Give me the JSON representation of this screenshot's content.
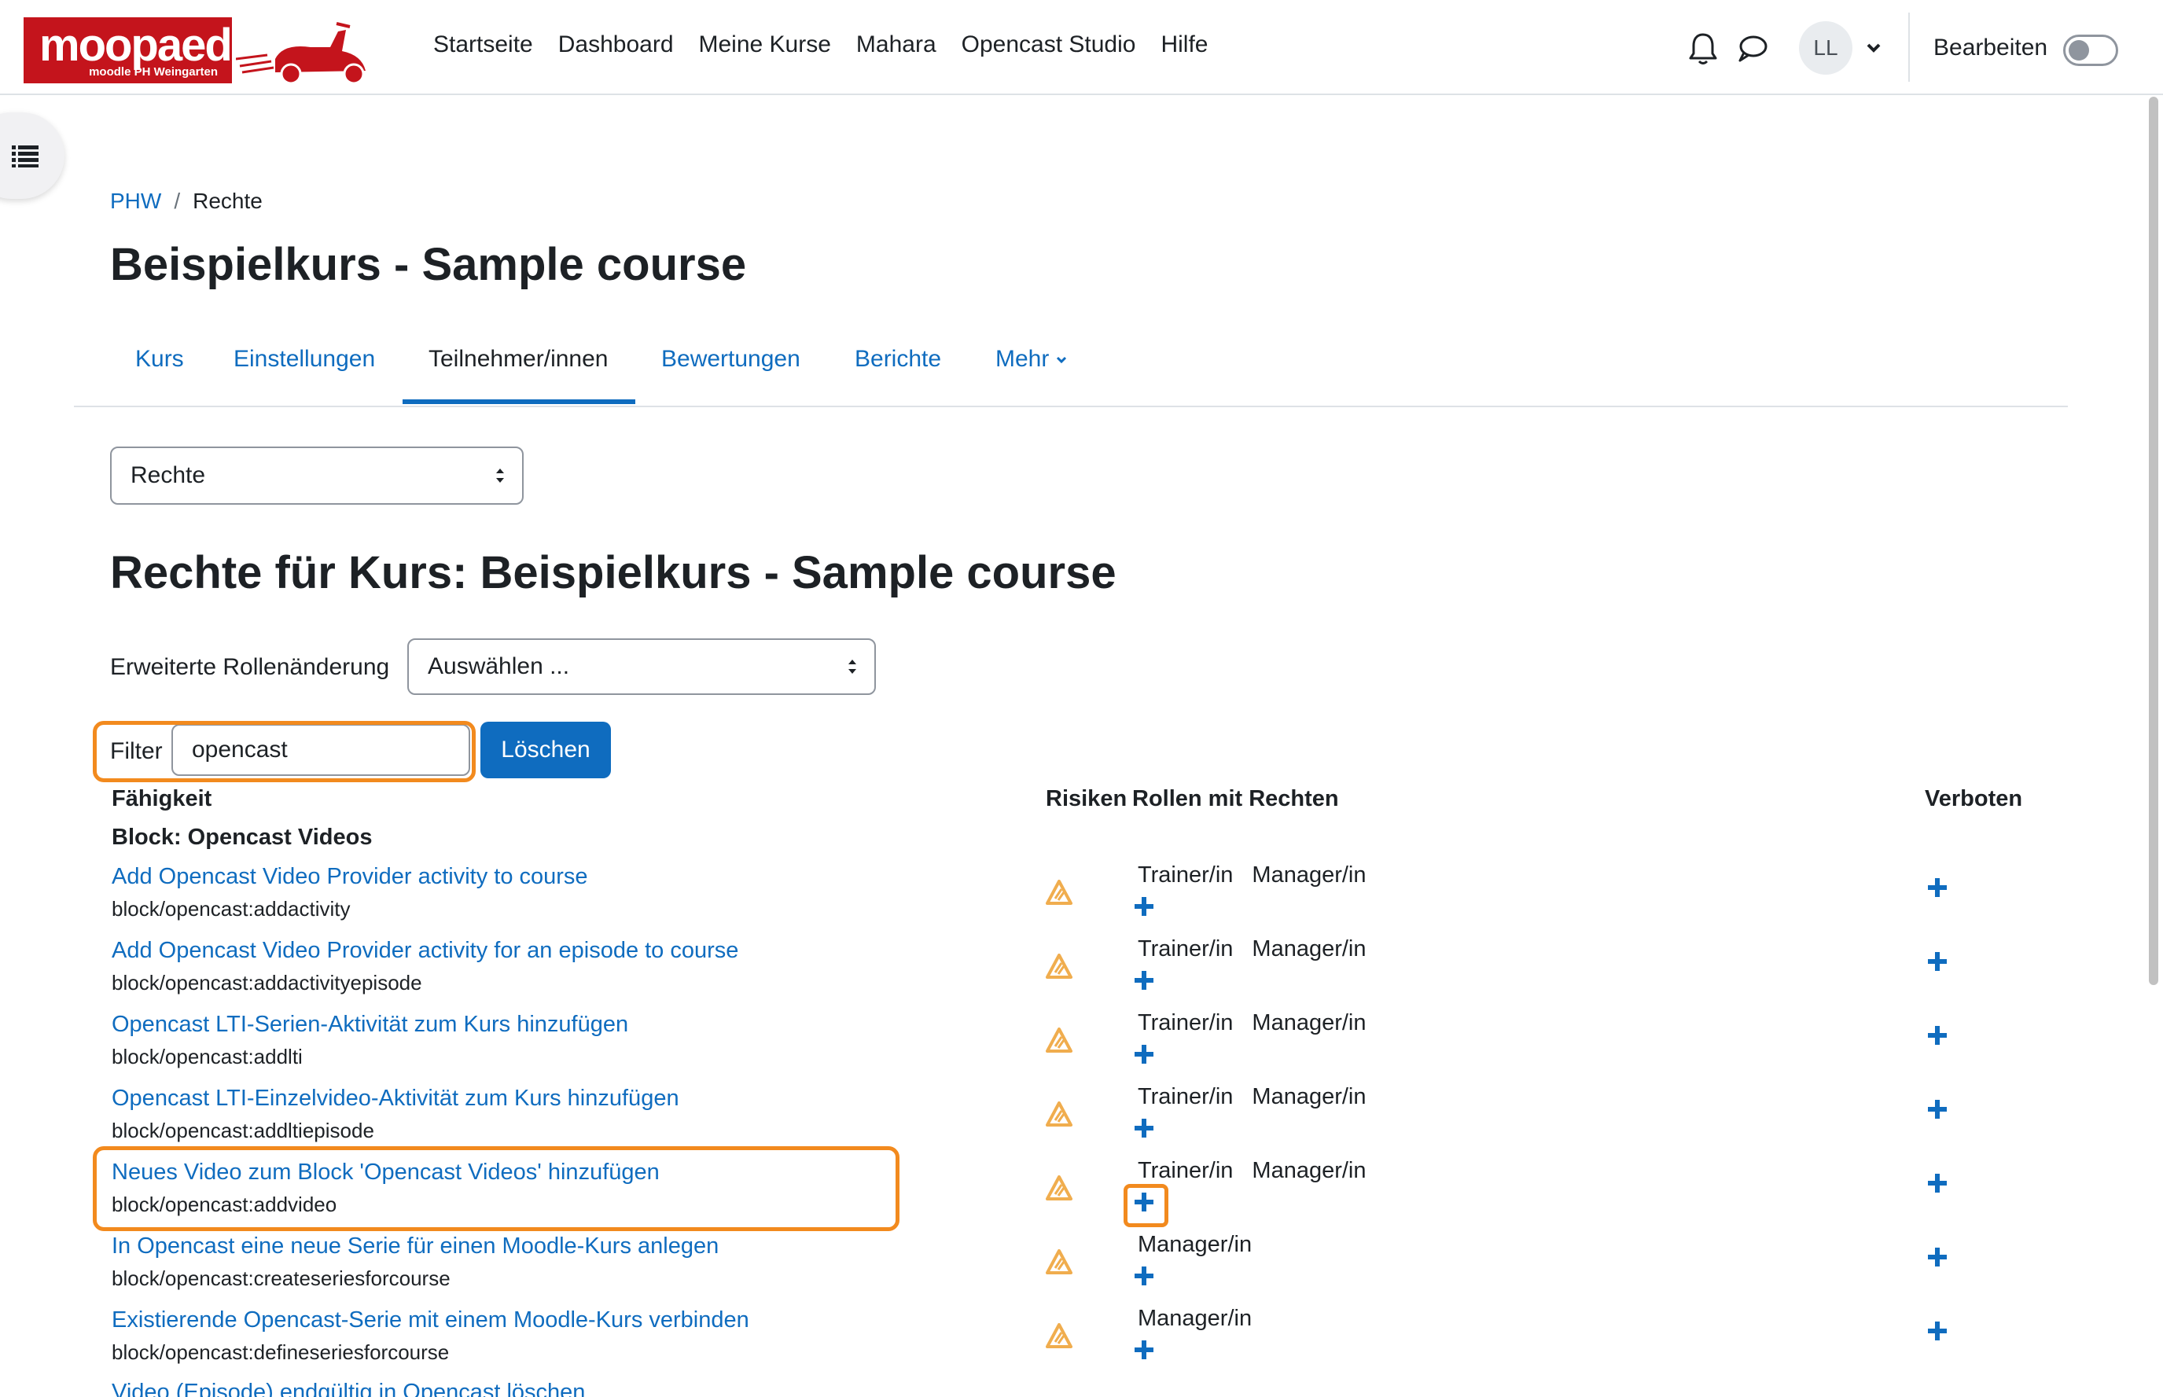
{
  "navbar": {
    "logo_text": "moopaed",
    "logo_subtext": "moodle PH Weingarten",
    "links": [
      "Startseite",
      "Dashboard",
      "Meine Kurse",
      "Mahara",
      "Opencast Studio",
      "Hilfe"
    ],
    "avatar_initials": "LL",
    "edit_mode_label": "Bearbeiten"
  },
  "breadcrumb": {
    "root": "PHW",
    "separator": "/",
    "current": "Rechte"
  },
  "page_title": "Beispielkurs - Sample course",
  "tabs": {
    "items": [
      "Kurs",
      "Einstellungen",
      "Teilnehmer/innen",
      "Bewertungen",
      "Berichte",
      "Mehr"
    ],
    "active": "Teilnehmer/innen"
  },
  "page_select": {
    "value": "Rechte"
  },
  "section_title": "Rechte für Kurs: Beispielkurs - Sample course",
  "role_change": {
    "label": "Erweiterte Rollenänderung",
    "value": "Auswählen ..."
  },
  "filter": {
    "label": "Filter",
    "value": "opencast",
    "clear_button": "Löschen"
  },
  "table": {
    "headers": {
      "capability": "Fähigkeit",
      "risks": "Risiken",
      "roles_with_permission": "Rollen mit Rechten",
      "prohibited": "Verboten"
    },
    "group_title": "Block: Opencast Videos",
    "rows": [
      {
        "name": "Add Opencast Video Provider activity to course",
        "id": "block/opencast:addactivity",
        "role_1": "Trainer/in",
        "role_2": "Manager/in"
      },
      {
        "name": "Add Opencast Video Provider activity for an episode to course",
        "id": "block/opencast:addactivityepisode",
        "role_1": "Trainer/in",
        "role_2": "Manager/in"
      },
      {
        "name": "Opencast LTI-Serien-Aktivität zum Kurs hinzufügen",
        "id": "block/opencast:addlti",
        "role_1": "Trainer/in",
        "role_2": "Manager/in"
      },
      {
        "name": "Opencast LTI-Einzelvideo-Aktivität zum Kurs hinzufügen",
        "id": "block/opencast:addltiepisode",
        "role_1": "Trainer/in",
        "role_2": "Manager/in"
      },
      {
        "name": "Neues Video zum Block 'Opencast Videos' hinzufügen",
        "id": "block/opencast:addvideo",
        "role_1": "Trainer/in",
        "role_2": "Manager/in"
      },
      {
        "name": "In Opencast eine neue Serie für einen Moodle-Kurs anlegen",
        "id": "block/opencast:createseriesforcourse",
        "role_1": "Manager/in",
        "role_2": ""
      },
      {
        "name": "Existierende Opencast-Serie mit einem Moodle-Kurs verbinden",
        "id": "block/opencast:defineseriesforcourse",
        "role_1": "Manager/in",
        "role_2": ""
      },
      {
        "name": "Video (Episode) endgültig in Opencast löschen",
        "id": "",
        "role_1": "",
        "role_2": ""
      }
    ]
  },
  "colors": {
    "link": "#0f6cbf",
    "primary_button": "#0f6cbf",
    "highlight": "#f28a1e",
    "risk": "#f0ad4e",
    "logo_red": "#c4141c"
  },
  "icons": [
    "bell-icon",
    "chat-icon",
    "chevron-down-icon",
    "list-icon",
    "risk-warning-icon",
    "plus-icon",
    "select-arrows-icon"
  ]
}
